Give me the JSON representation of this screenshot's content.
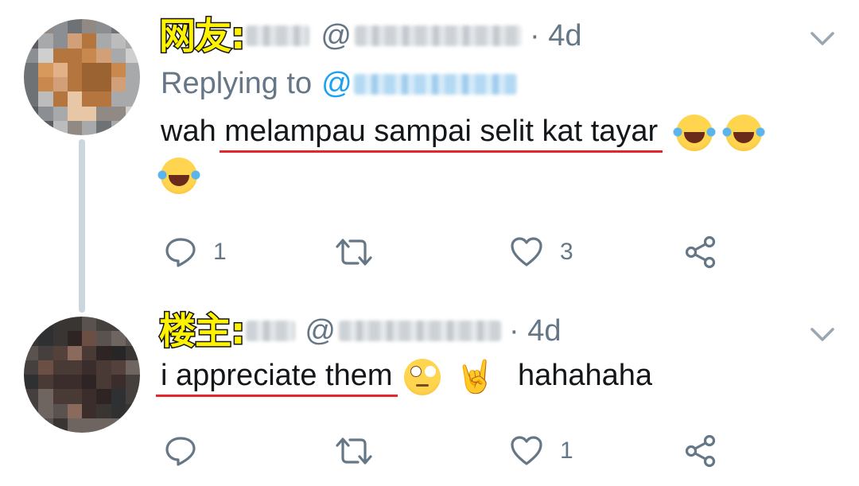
{
  "tweets": [
    {
      "tag": "网友:",
      "handle_prefix": "@",
      "time": "· 4d",
      "replying_prefix": "Replying to",
      "mention_prefix": "@",
      "text_plain": "wah ",
      "text_underlined": "melampau sampai selit kat tayar",
      "emojis": [
        "face-with-tears-of-joy",
        "face-with-tears-of-joy",
        "face-with-tears-of-joy"
      ],
      "replies": "1",
      "retweets": "",
      "likes": "3"
    },
    {
      "tag": "楼主:",
      "handle_prefix": "@",
      "time": "· 4d",
      "text_underlined": "i appreciate them",
      "emojis": [
        "face-with-rolling-eyes",
        "sign-of-the-horns"
      ],
      "text_after": "hahahaha",
      "replies": "",
      "retweets": "",
      "likes": "1"
    }
  ],
  "colors": {
    "tag_fill": "#fff200",
    "underline": "#e5262a",
    "secondary_text": "#657786",
    "link": "#1da1f2",
    "thread_line": "#ccd6dd"
  }
}
